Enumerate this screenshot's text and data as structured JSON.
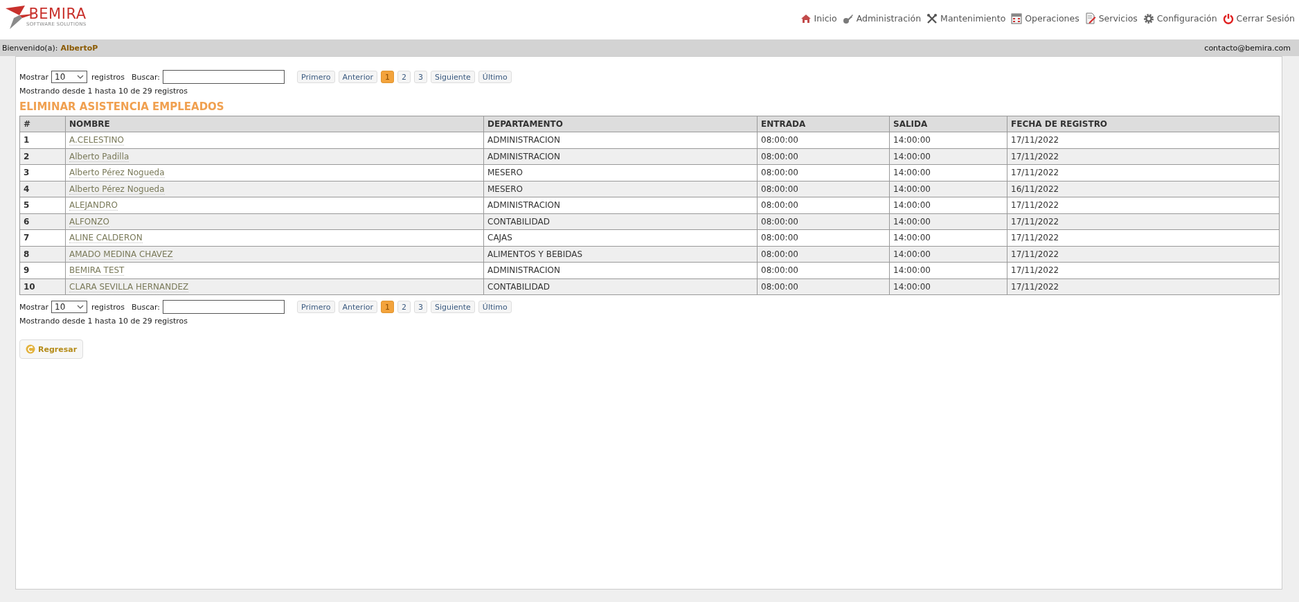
{
  "header": {
    "logo": {
      "name": "BEMIRA",
      "tagline": "SOFTWARE SOLUTIONS"
    },
    "nav": [
      {
        "label": "Inicio",
        "kind": "home"
      },
      {
        "label": "Administración",
        "kind": "admin"
      },
      {
        "label": "Mantenimiento",
        "kind": "maintenance"
      },
      {
        "label": "Operaciones",
        "kind": "operations"
      },
      {
        "label": "Servicios",
        "kind": "services"
      },
      {
        "label": "Configuración",
        "kind": "settings"
      },
      {
        "label": "Cerrar Sesión",
        "kind": "logout"
      }
    ]
  },
  "welcome_bar": {
    "label": "Bienvenido(a):",
    "user": "AlbertoP",
    "contact": "contacto@bemira.com"
  },
  "pagers": [
    {
      "show_label": "Mostrar",
      "page_size": "10",
      "records_label": "registros",
      "search_label": "Buscar:",
      "pages": [
        {
          "label": "Primero",
          "selected": false
        },
        {
          "label": "Anterior",
          "selected": false
        },
        {
          "label": "1",
          "selected": true
        },
        {
          "label": "2",
          "selected": false
        },
        {
          "label": "3",
          "selected": false
        },
        {
          "label": "Siguiente",
          "selected": false
        },
        {
          "label": "Último",
          "selected": false
        }
      ],
      "info": "Mostrando desde 1 hasta 10 de 29 registros"
    },
    {
      "show_label": "Mostrar",
      "page_size": "10",
      "records_label": "registros",
      "search_label": "Buscar:",
      "pages": [
        {
          "label": "Primero",
          "selected": false
        },
        {
          "label": "Anterior",
          "selected": false
        },
        {
          "label": "1",
          "selected": true
        },
        {
          "label": "2",
          "selected": false
        },
        {
          "label": "3",
          "selected": false
        },
        {
          "label": "Siguiente",
          "selected": false
        },
        {
          "label": "Último",
          "selected": false
        }
      ],
      "info": "Mostrando desde 1 hasta 10 de 29 registros"
    }
  ],
  "title": "ELIMINAR ASISTENCIA EMPLEADOS",
  "table": {
    "columns": [
      "#",
      "NOMBRE",
      "DEPARTAMENTO",
      "ENTRADA",
      "SALIDA",
      "FECHA DE REGISTRO"
    ],
    "rows": [
      [
        "1",
        "A.CELESTINO",
        "ADMINISTRACION",
        "08:00:00",
        "14:00:00",
        "17/11/2022"
      ],
      [
        "2",
        "Alberto Padilla",
        "ADMINISTRACION",
        "08:00:00",
        "14:00:00",
        "17/11/2022"
      ],
      [
        "3",
        "Alberto Pérez Nogueda",
        "MESERO",
        "08:00:00",
        "14:00:00",
        "17/11/2022"
      ],
      [
        "4",
        "Alberto Pérez Nogueda",
        "MESERO",
        "08:00:00",
        "14:00:00",
        "16/11/2022"
      ],
      [
        "5",
        "ALEJANDRO",
        "ADMINISTRACION",
        "08:00:00",
        "14:00:00",
        "17/11/2022"
      ],
      [
        "6",
        "ALFONZO",
        "CONTABILIDAD",
        "08:00:00",
        "14:00:00",
        "17/11/2022"
      ],
      [
        "7",
        "ALINE CALDERON",
        "CAJAS",
        "08:00:00",
        "14:00:00",
        "17/11/2022"
      ],
      [
        "8",
        "AMADO MEDINA CHAVEZ",
        "ALIMENTOS Y BEBIDAS",
        "08:00:00",
        "14:00:00",
        "17/11/2022"
      ],
      [
        "9",
        "BEMIRA TEST",
        "ADMINISTRACION",
        "08:00:00",
        "14:00:00",
        "17/11/2022"
      ],
      [
        "10",
        "CLARA SEVILLA HERNANDEZ",
        "CONTABILIDAD",
        "08:00:00",
        "14:00:00",
        "17/11/2022"
      ]
    ]
  },
  "back_button": "Regresar"
}
